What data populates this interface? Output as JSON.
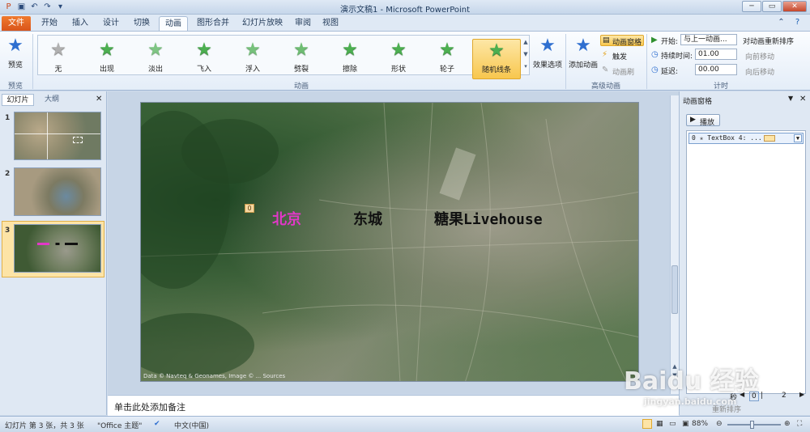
{
  "window": {
    "title": "演示文稿1 - Microsoft PowerPoint"
  },
  "tabs": [
    {
      "label": "文件"
    },
    {
      "label": "开始"
    },
    {
      "label": "插入"
    },
    {
      "label": "设计"
    },
    {
      "label": "切换"
    },
    {
      "label": "动画"
    },
    {
      "label": "图形合并"
    },
    {
      "label": "幻灯片放映"
    },
    {
      "label": "审阅"
    },
    {
      "label": "视图"
    }
  ],
  "ribbon": {
    "preview": {
      "label": "预览",
      "group": "预览"
    },
    "animations": [
      {
        "label": "无"
      },
      {
        "label": "出现"
      },
      {
        "label": "淡出"
      },
      {
        "label": "飞入"
      },
      {
        "label": "浮入"
      },
      {
        "label": "劈裂"
      },
      {
        "label": "擦除"
      },
      {
        "label": "形状"
      },
      {
        "label": "轮子"
      },
      {
        "label": "随机线条"
      }
    ],
    "effect_options": "效果选项",
    "anim_group": "动画",
    "add_animation": "添加动画",
    "anim_pane_btn": "动画窗格",
    "trigger": "触发",
    "anim_painter": "动画刷",
    "adv_group": "高级动画",
    "start_label": "开始:",
    "start_value": "与上一动画...",
    "duration_label": "持续时间:",
    "duration_value": "01.00",
    "delay_label": "延迟:",
    "delay_value": "00.00",
    "reorder_label": "对动画重新排序",
    "move_earlier": "向前移动",
    "move_later": "向后移动",
    "timing_group": "计时"
  },
  "left_pane": {
    "tab_slides": "幻灯片",
    "tab_outline": "大纲",
    "slides": [
      {
        "num": "1"
      },
      {
        "num": "2"
      },
      {
        "num": "3"
      }
    ]
  },
  "slide": {
    "text_beijing": "北京",
    "text_dongcheng": "东城",
    "text_venue": "糖果Livehouse",
    "badge": "0",
    "credit": "Data © Navteq & Geonames, Image © ... Sources"
  },
  "notes": {
    "placeholder": "单击此处添加备注"
  },
  "anim_pane": {
    "title": "动画窗格",
    "play": "播放",
    "item": "0 ✭ TextBox 4: ...",
    "unit": "秒",
    "timeline_start": "0",
    "timeline_end": "2",
    "reorder": "重新排序"
  },
  "status": {
    "slide_info": "幻灯片 第 3 张，共 3 张",
    "theme": "\"Office 主题\"",
    "language": "中文(中国)",
    "zoom": "88%"
  },
  "watermark": {
    "brand": "Baidu 经验",
    "url": "jingyan.baidu.com"
  },
  "colors": {
    "accent_orange": "#d9551a",
    "star_green": "#4caf50",
    "selected_gold": "#f8c74e",
    "text_magenta": "#e238c8"
  }
}
